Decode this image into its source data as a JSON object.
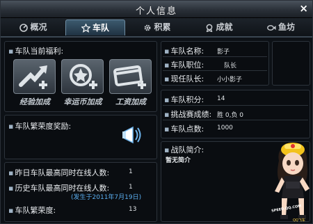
{
  "window": {
    "title": "个人信息",
    "close_label": "×"
  },
  "tabs": [
    {
      "label": "概况",
      "icon": "gauge-icon"
    },
    {
      "label": "车队",
      "icon": "star-icon"
    },
    {
      "label": "积累",
      "icon": "gear-icon"
    },
    {
      "label": "成就",
      "icon": "medal-icon"
    },
    {
      "label": "鱼坊",
      "icon": "fish-icon"
    }
  ],
  "active_tab": "车队",
  "benefits": {
    "heading": "车队当前福利:",
    "items": [
      {
        "label": "经验加成",
        "icon": "exp-arrow-icon"
      },
      {
        "label": "幸运币加成",
        "icon": "coin-icon"
      },
      {
        "label": "工资加成",
        "icon": "card-icon"
      }
    ]
  },
  "prosperity_reward": {
    "label": "车队繁荣度奖励:"
  },
  "online": {
    "yesterday_label": "昨日车队最高同时在线人数:",
    "yesterday_value": "1",
    "history_label": "历史车队最高同时在线人数:",
    "history_value": "1",
    "history_note": "(发生于2011年7月19日)",
    "prosperity_label": "车队繁荣度:",
    "prosperity_value": "13"
  },
  "team": {
    "name_label": "车队名称:",
    "name_value": "影子",
    "position_label": "车队职位:",
    "position_value": "队长",
    "leader_label": "现任队长:",
    "leader_value": "小小影子"
  },
  "stats": {
    "points_label": "车队积分:",
    "points_value": "14",
    "record_label": "挑战赛成绩:",
    "record_value": "胜 0,负 0",
    "total_label": "车队点数:",
    "total_value": "1000"
  },
  "intro": {
    "label": "战队简介:",
    "text": "暂无简介"
  },
  "mascot": {
    "logo_text": "SPEED.QQ.COM",
    "caption": "QQ飞车"
  },
  "colors": {
    "accent": "#5aaef0",
    "panel_border": "#2c333b",
    "tab_active": "#3c5a6e"
  }
}
